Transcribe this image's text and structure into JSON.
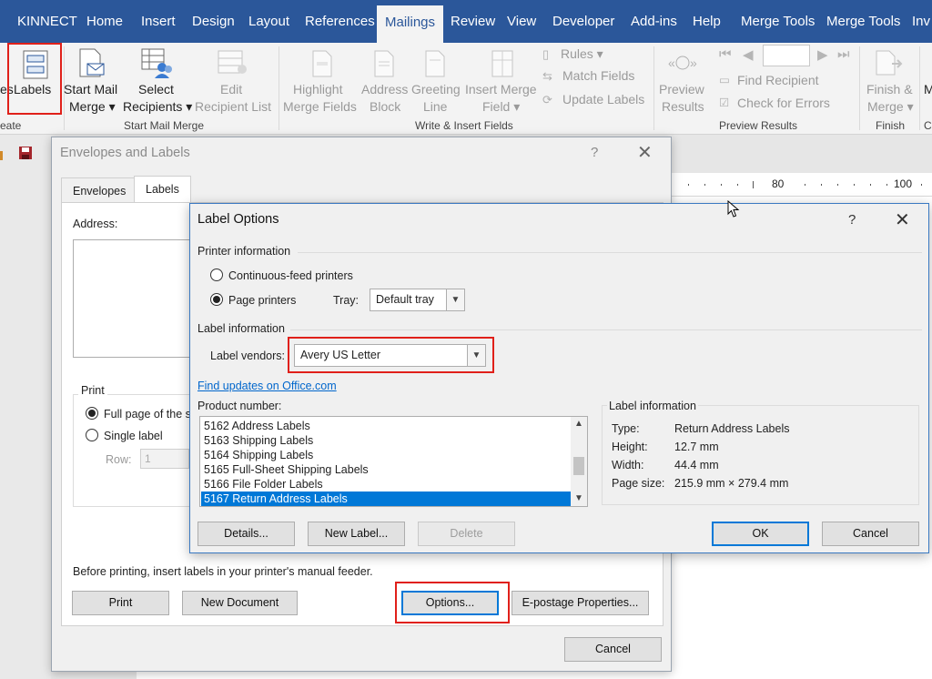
{
  "ribbon": {
    "tabs": [
      "KINNECT",
      "Home",
      "Insert",
      "Design",
      "Layout",
      "References",
      "Mailings",
      "Review",
      "View",
      "Developer",
      "Add-ins",
      "Help",
      "Merge Tools",
      "Merge Tools",
      "Inv"
    ],
    "active_tab": "Mailings",
    "buttons": {
      "envelopes_fragment": "es",
      "labels": "Labels",
      "start_mail_merge_1": "Start Mail",
      "start_mail_merge_2": "Merge",
      "select_recipients_1": "Select",
      "select_recipients_2": "Recipients",
      "edit_list_1": "Edit",
      "edit_list_2": "Recipient List",
      "highlight_1": "Highlight",
      "highlight_2": "Merge Fields",
      "address_1": "Address",
      "address_2": "Block",
      "greeting_1": "Greeting",
      "greeting_2": "Line",
      "insert_merge_1": "Insert Merge",
      "insert_merge_2": "Field",
      "rules": "Rules",
      "match_fields": "Match Fields",
      "update_labels": "Update Labels",
      "preview_1": "Preview",
      "preview_2": "Results",
      "find_recipient": "Find Recipient",
      "check_errors": "Check for Errors",
      "finish_1": "Finish &",
      "finish_2": "Merge",
      "partial_m": "M"
    },
    "groups": {
      "create_fragment": "eate",
      "start_mail_merge": "Start Mail Merge",
      "write_insert": "Write & Insert Fields",
      "preview_results": "Preview Results",
      "finish": "Finish",
      "partial_c": "C"
    }
  },
  "ruler": {
    "mark_80": "80",
    "mark_100": "100"
  },
  "envelopes_dialog": {
    "title": "Envelopes and Labels",
    "help": "?",
    "tabs": [
      "Envelopes",
      "Labels"
    ],
    "address_label": "Address:",
    "print_group": "Print",
    "full_page": "Full page of the s",
    "single_label": "Single label",
    "row_label": "Row:",
    "row_value": "1",
    "note": "Before printing, insert labels in your printer's manual feeder.",
    "buttons": {
      "print": "Print",
      "new_document": "New Document",
      "options": "Options...",
      "epostage": "E-postage Properties...",
      "cancel": "Cancel"
    }
  },
  "label_options": {
    "title": "Label Options",
    "help": "?",
    "printer_info": "Printer information",
    "continuous": "Continuous-feed printers",
    "page_printers": "Page printers",
    "tray_label": "Tray:",
    "tray_value": "Default tray",
    "label_info_header": "Label information",
    "vendors_label": "Label vendors:",
    "vendors_value": "Avery US Letter",
    "find_updates": "Find updates on Office.com",
    "product_number": "Product number:",
    "products": [
      "5162 Address Labels",
      "5163 Shipping Labels",
      "5164 Shipping Labels",
      "5165 Full-Sheet Shipping Labels",
      "5166 File Folder Labels",
      "5167 Return Address Labels"
    ],
    "selected_product": "5167 Return Address Labels",
    "info_box": {
      "header": "Label information",
      "type_label": "Type:",
      "type_value": "Return Address Labels",
      "height_label": "Height:",
      "height_value": "12.7 mm",
      "width_label": "Width:",
      "width_value": "44.4 mm",
      "page_label": "Page size:",
      "page_value": "215.9 mm × 279.4 mm"
    },
    "buttons": {
      "details": "Details...",
      "new_label": "New Label...",
      "delete": "Delete",
      "ok": "OK",
      "cancel": "Cancel"
    }
  }
}
